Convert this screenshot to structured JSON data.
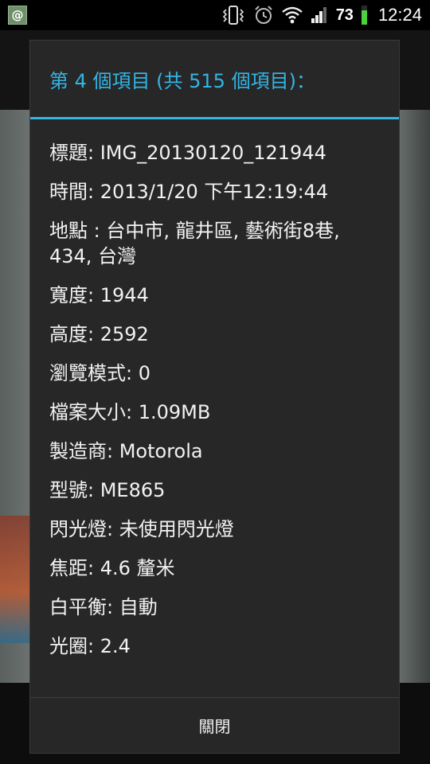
{
  "status_bar": {
    "notification_glyph": "@",
    "battery_percent": 73,
    "battery_text": "73",
    "time": "12:24",
    "battery_color": "#4cd03d"
  },
  "dialog": {
    "title": "第 4 個項目 (共 515 個項目)：",
    "accent_color": "#33b5e5",
    "details": [
      {
        "text": "標題: IMG_20130120_121944"
      },
      {
        "text": "時間: 2013/1/20 下午12:19:44"
      },
      {
        "text": "地點 : 台中市, 龍井區, 藝術街8巷, 434, 台灣"
      },
      {
        "text": "寬度: 1944"
      },
      {
        "text": "高度: 2592"
      },
      {
        "text": "瀏覽模式: 0"
      },
      {
        "text": "檔案大小: 1.09MB"
      },
      {
        "text": "製造商: Motorola"
      },
      {
        "text": "型號: ME865"
      },
      {
        "text": "閃光燈: 未使用閃光燈"
      },
      {
        "text": "焦距: 4.6 釐米"
      },
      {
        "text": "白平衡: 自動"
      },
      {
        "text": "光圈: 2.4"
      }
    ],
    "close_label": "關閉"
  }
}
